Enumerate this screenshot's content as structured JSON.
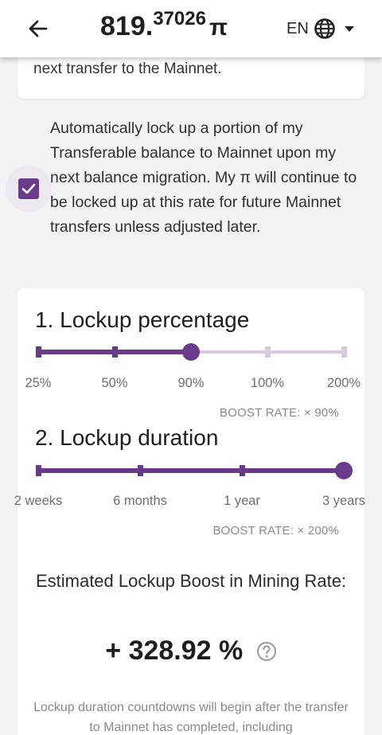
{
  "header": {
    "balance_int": "819.",
    "balance_dec": "37026",
    "currency_symbol": "π",
    "language": "EN"
  },
  "top_card": {
    "text": "next transfer to the Mainnet."
  },
  "consent": {
    "checked": true,
    "text": "Automatically lock up a portion of my Transferable balance to Mainnet upon my next balance migration. My π will continue to be locked up at this rate for future Mainnet transfers unless adjusted later."
  },
  "lockup_percentage": {
    "title": "1. Lockup percentage",
    "options": [
      "25%",
      "50%",
      "90%",
      "100%",
      "200%"
    ],
    "selected_index": 2,
    "boost_rate": "BOOST RATE: × 90%"
  },
  "lockup_duration": {
    "title": "2. Lockup duration",
    "options": [
      "2 weeks",
      "6 months",
      "1 year",
      "3 years"
    ],
    "selected_index": 3,
    "boost_rate": "BOOST RATE: × 200%"
  },
  "estimate": {
    "title": "Estimated Lockup Boost in Mining Rate:",
    "value": "+ 328.92 %"
  },
  "footnote": "Lockup duration countdowns will begin after the transfer to Mainnet has completed, including",
  "colors": {
    "accent": "#6a3a8a",
    "accent_light": "#d7c9e2"
  }
}
